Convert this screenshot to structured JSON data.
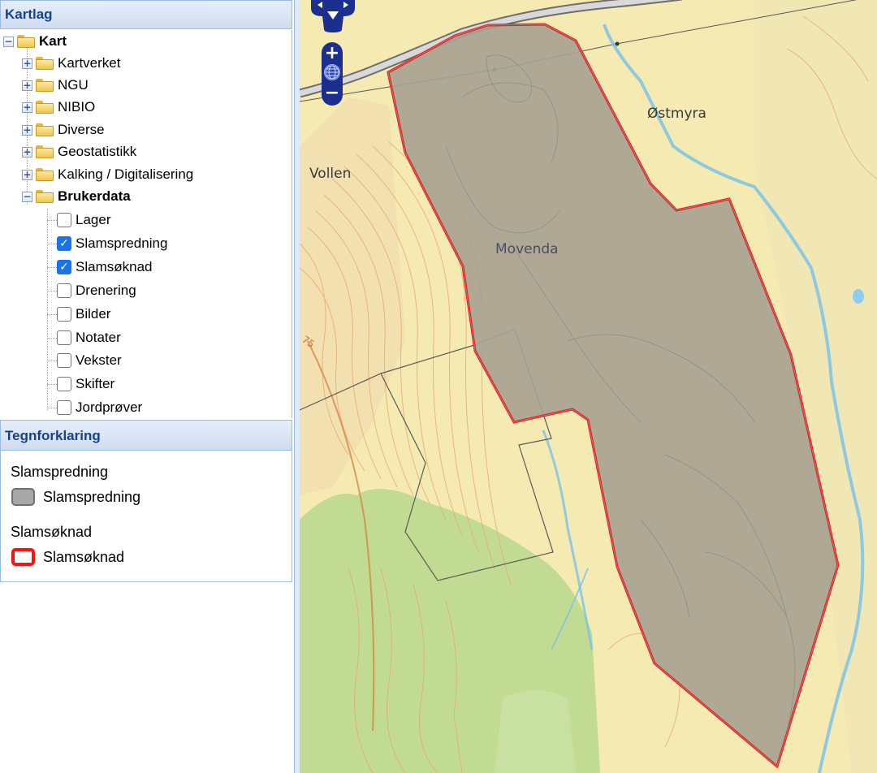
{
  "panel": {
    "title": "Kartlag"
  },
  "tree": {
    "root": "Kart",
    "folders": [
      "Kartverket",
      "NGU",
      "NIBIO",
      "Diverse",
      "Geostatistikk",
      "Kalking / Digitalisering"
    ],
    "open_folder": "Brukerdata",
    "layers": [
      {
        "label": "Lager",
        "checked": false
      },
      {
        "label": "Slamspredning",
        "checked": true
      },
      {
        "label": "Slamsøknad",
        "checked": true
      },
      {
        "label": "Drenering",
        "checked": false
      },
      {
        "label": "Bilder",
        "checked": false
      },
      {
        "label": "Notater",
        "checked": false
      },
      {
        "label": "Vekster",
        "checked": false
      },
      {
        "label": "Skifter",
        "checked": false
      },
      {
        "label": "Jordprøver",
        "checked": false
      }
    ]
  },
  "legend": {
    "title": "Tegnforklaring",
    "groups": [
      {
        "title": "Slamspredning",
        "item": "Slamspredning",
        "style": "grey"
      },
      {
        "title": "Slamsøknad",
        "item": "Slamsøknad",
        "style": "red"
      }
    ]
  },
  "map": {
    "labels": [
      "Vollen",
      "Movenda",
      "Østmyra",
      "75"
    ],
    "zoom_in": "+",
    "zoom_out": "−",
    "colors": {
      "background": "#f6eab3",
      "forest": "#b9d98a",
      "contour": "#e9a36a",
      "polygon_fill": "#a7a291",
      "polygon_stroke": "#ff1010",
      "water": "#7cc3e6"
    }
  }
}
